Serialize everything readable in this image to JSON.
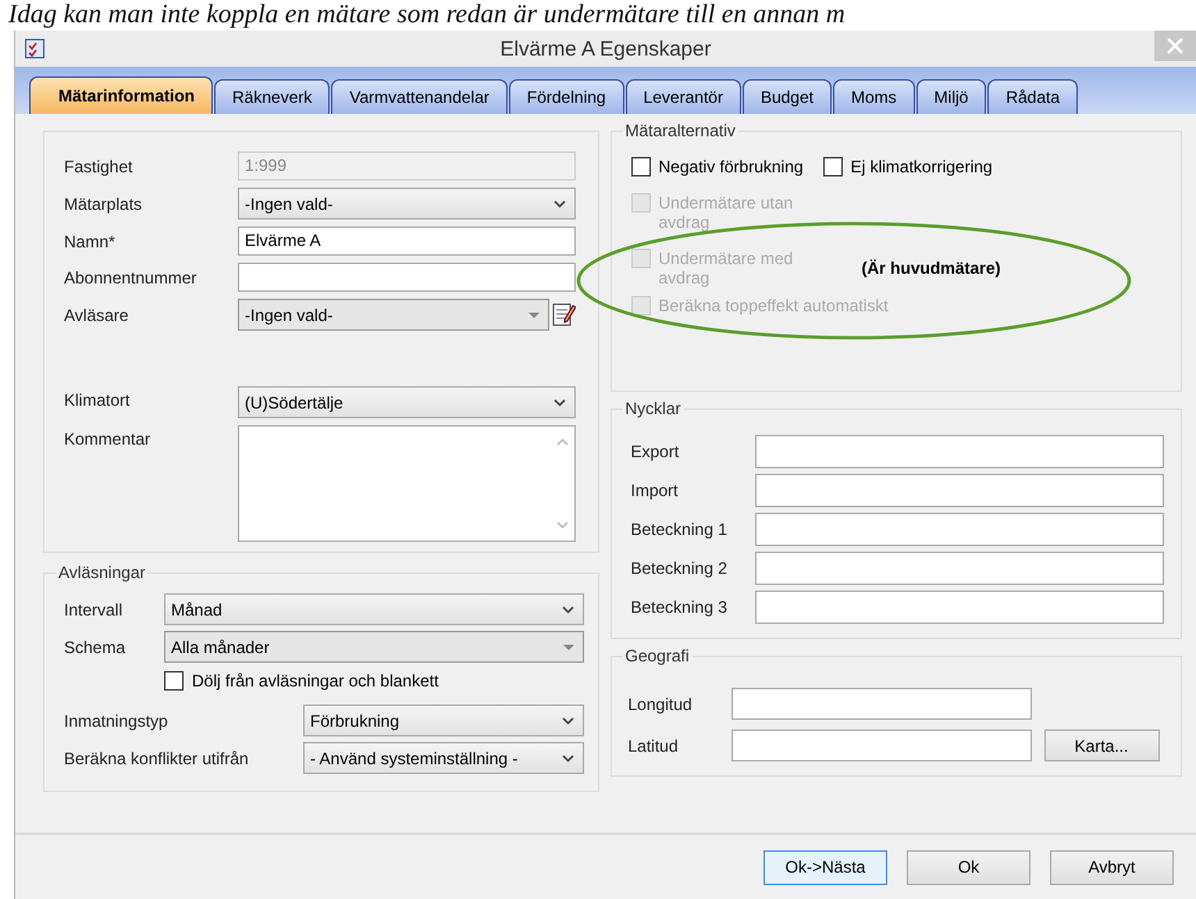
{
  "document_text": "Idag kan man inte koppla en mätare som redan är undermätare till en annan m",
  "window": {
    "title": "Elvärme A Egenskaper"
  },
  "tabs": [
    {
      "label": "Mätarinformation",
      "selected": true
    },
    {
      "label": "Räkneverk",
      "selected": false
    },
    {
      "label": "Varmvattenandelar",
      "selected": false
    },
    {
      "label": "Fördelning",
      "selected": false
    },
    {
      "label": "Leverantör",
      "selected": false
    },
    {
      "label": "Budget",
      "selected": false
    },
    {
      "label": "Moms",
      "selected": false
    },
    {
      "label": "Miljö",
      "selected": false
    },
    {
      "label": "Rådata",
      "selected": false
    }
  ],
  "meter_fields": [
    {
      "label": "Fastighet",
      "kind": "readonly",
      "value": "1:999"
    },
    {
      "label": "Mätarplats",
      "kind": "dropdown",
      "value": "-Ingen vald-"
    },
    {
      "label": "Namn*",
      "kind": "text",
      "value": "Elvärme A"
    },
    {
      "label": "Abonnentnummer",
      "kind": "text"
    },
    {
      "label": "Avläsare",
      "kind": "combo_edit",
      "value": "-Ingen vald-"
    }
  ],
  "location_fields": [
    {
      "label": "Klimatort",
      "kind": "dropdown",
      "value": "(U)Södertälje"
    },
    {
      "label": "Kommentar",
      "kind": "textarea"
    }
  ],
  "readings": {
    "title": "Avläsningar",
    "fields": [
      {
        "label": "Intervall",
        "kind": "dropdown",
        "value": "Månad"
      },
      {
        "label": "Schema",
        "kind": "combo",
        "value": "Alla månader"
      }
    ],
    "hide_option": {
      "label": "Dölj från avläsningar och blankett",
      "checked": false
    },
    "extra_fields": [
      {
        "label": "Inmatningstyp",
        "kind": "dropdown",
        "value": "Förbrukning"
      },
      {
        "label": "Beräkna konflikter utifrån",
        "kind": "dropdown",
        "value": "- Använd systeminställning -"
      }
    ]
  },
  "meter_options": {
    "title": "Mätaralternativ",
    "options": [
      {
        "label": "Negativ förbrukning",
        "checked": false,
        "disabled": false
      },
      {
        "label": "Ej klimatkorrigering",
        "checked": false,
        "disabled": false
      },
      {
        "label": "Undermätare utan avdrag",
        "checked": false,
        "disabled": true
      },
      {
        "label": "Undermätare med avdrag",
        "checked": false,
        "disabled": true
      },
      {
        "label": "Beräkna toppeffekt automatiskt",
        "checked": false,
        "disabled": true
      }
    ],
    "annotation": "(Är huvudmätare)"
  },
  "keys": {
    "title": "Nycklar",
    "fields": [
      {
        "label": "Export"
      },
      {
        "label": "Import"
      },
      {
        "label": "Beteckning 1"
      },
      {
        "label": "Beteckning 2"
      },
      {
        "label": "Beteckning 3"
      }
    ]
  },
  "geography": {
    "title": "Geografi",
    "fields": [
      {
        "label": "Longitud"
      },
      {
        "label": "Latitud"
      }
    ],
    "map_button": "Karta..."
  },
  "buttons": [
    {
      "label": "Ok->Nästa",
      "default": true
    },
    {
      "label": "Ok",
      "default": false
    },
    {
      "label": "Avbryt",
      "default": false
    }
  ]
}
